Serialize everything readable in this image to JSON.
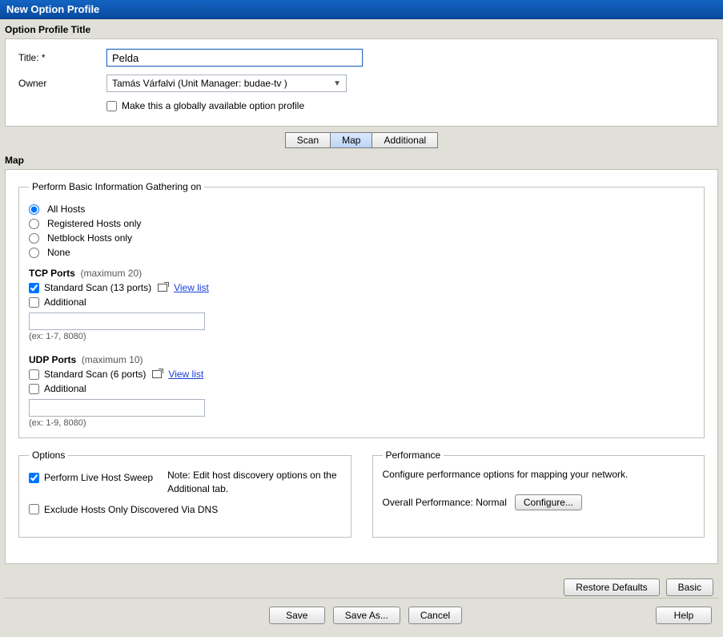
{
  "window": {
    "title": "New Option Profile"
  },
  "profile": {
    "legend": "Option Profile Title",
    "title_label": "Title: *",
    "title_value": "Pelda",
    "owner_label": "Owner",
    "owner_value": "Tamás Várfalvi (Unit Manager: budae-tv )",
    "global_label": "Make this a globally available option profile"
  },
  "tabs": {
    "scan": "Scan",
    "map": "Map",
    "additional": "Additional"
  },
  "map": {
    "legend": "Map",
    "gather": {
      "legend": "Perform Basic Information Gathering on",
      "all": "All Hosts",
      "registered": "Registered Hosts only",
      "netblock": "Netblock Hosts only",
      "none": "None",
      "tcp_head": "TCP Ports",
      "tcp_hint": "(maximum 20)",
      "tcp_std": "Standard Scan (13 ports)",
      "view_list": "View list",
      "additional": "Additional",
      "tcp_ex": "(ex: 1-7, 8080)",
      "udp_head": "UDP Ports",
      "udp_hint": "(maximum 10)",
      "udp_std": "Standard Scan (6 ports)",
      "udp_ex": "(ex: 1-9, 8080)"
    },
    "options": {
      "legend": "Options",
      "live_sweep": "Perform Live Host Sweep",
      "note": "Note: Edit host discovery options on the Additional tab.",
      "exclude_dns": "Exclude Hosts Only Discovered Via DNS"
    },
    "performance": {
      "legend": "Performance",
      "desc": "Configure performance options for mapping your network.",
      "overall_label": "Overall Performance:",
      "overall_value": "Normal",
      "configure": "Configure..."
    }
  },
  "footer": {
    "restore": "Restore Defaults",
    "basic": "Basic",
    "save": "Save",
    "save_as": "Save As...",
    "cancel": "Cancel",
    "help": "Help"
  }
}
